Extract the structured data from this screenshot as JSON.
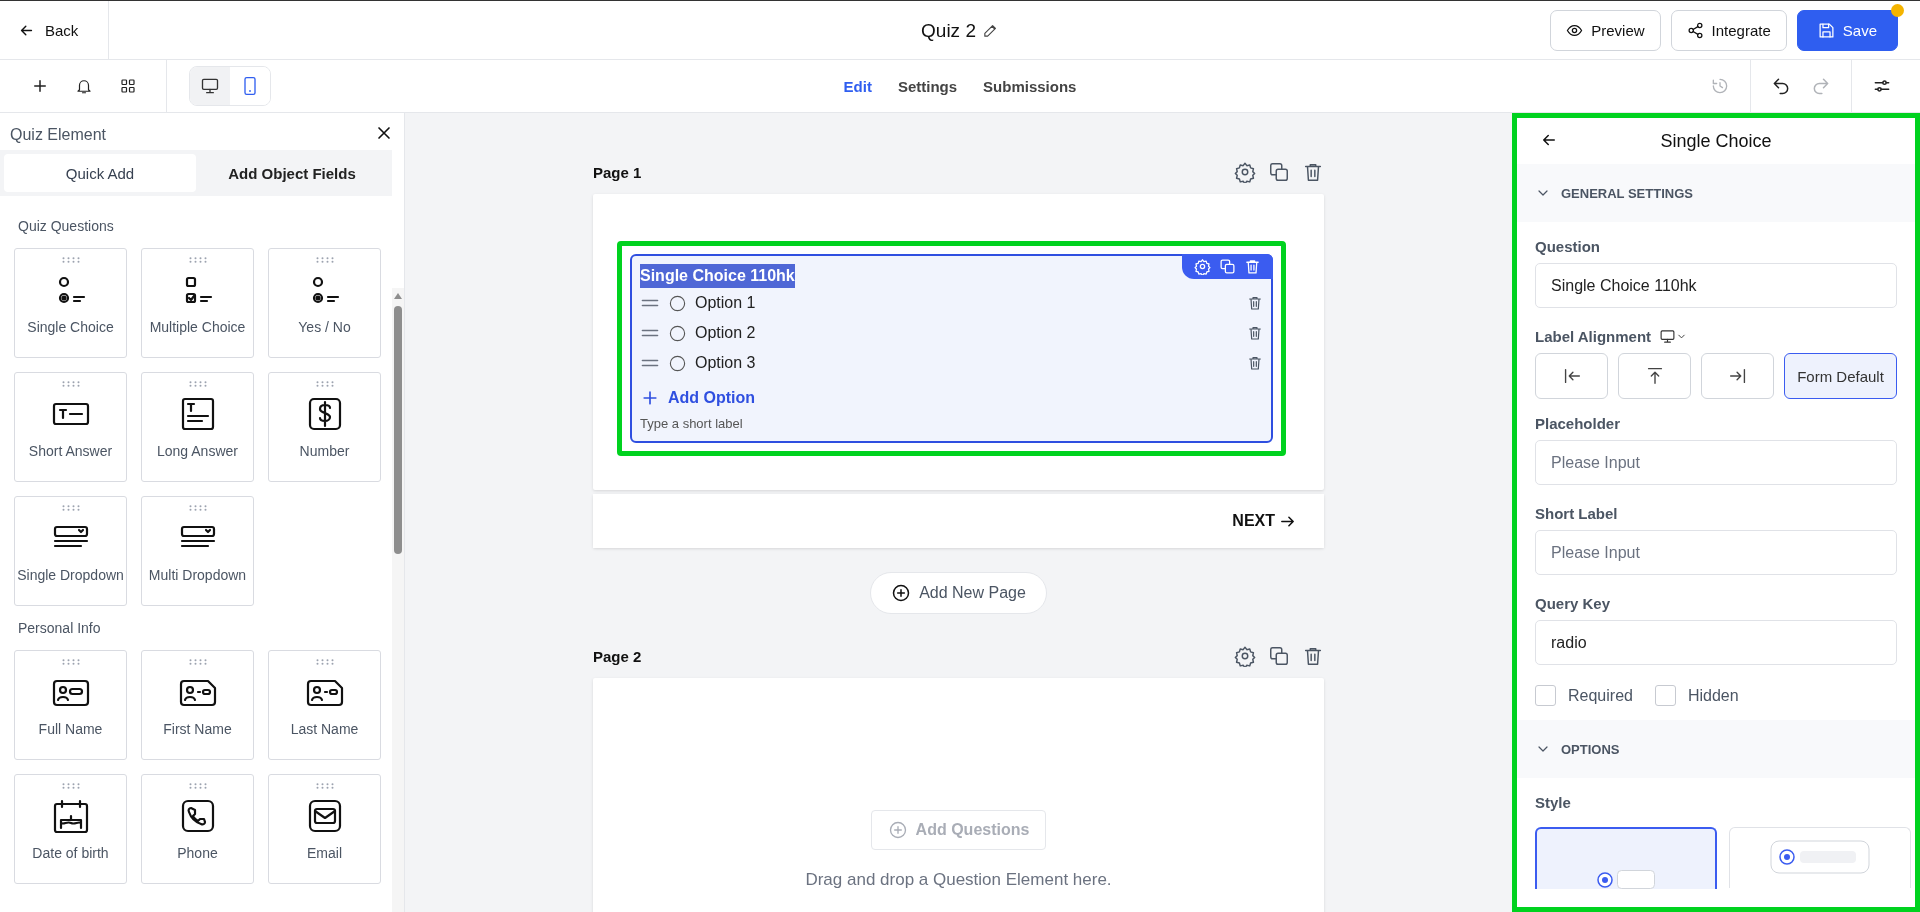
{
  "header": {
    "back": "Back",
    "title": "Quiz 2",
    "buttons": [
      {
        "label": "Preview",
        "kind": "preview",
        "unsaved": false
      },
      {
        "label": "Integrate",
        "kind": "integrate",
        "unsaved": false
      },
      {
        "label": "Save",
        "kind": "save",
        "unsaved": true
      }
    ]
  },
  "toolbar": {
    "devices": [
      {
        "kind": "desktop",
        "selected": false
      },
      {
        "kind": "mobile",
        "selected": true
      }
    ],
    "tabs": [
      {
        "label": "Edit",
        "selected": true
      },
      {
        "label": "Settings",
        "selected": false
      },
      {
        "label": "Submissions",
        "selected": false
      }
    ]
  },
  "sidebar": {
    "title": "Quiz Element",
    "tabs": [
      {
        "label": "Quick Add",
        "selected": true
      },
      {
        "label": "Add Object Fields",
        "selected": false
      }
    ],
    "sections": [
      {
        "title": "Quiz Questions",
        "items": [
          {
            "label": "Single Choice",
            "kind": "single-choice"
          },
          {
            "label": "Multiple Choice",
            "kind": "multiple-choice"
          },
          {
            "label": "Yes / No",
            "kind": "single-choice"
          },
          {
            "label": "Short Answer",
            "kind": "short-answer"
          },
          {
            "label": "Long Answer",
            "kind": "long-answer"
          },
          {
            "label": "Number",
            "kind": "number"
          },
          {
            "label": "Single Dropdown",
            "kind": "dropdown"
          },
          {
            "label": "Multi Dropdown",
            "kind": "dropdown"
          }
        ]
      },
      {
        "title": "Personal Info",
        "items": [
          {
            "label": "Full Name",
            "kind": "full-name"
          },
          {
            "label": "First Name",
            "kind": "first-name"
          },
          {
            "label": "Last Name",
            "kind": "first-name"
          },
          {
            "label": "Date of birth",
            "kind": "date"
          },
          {
            "label": "Phone",
            "kind": "phone"
          },
          {
            "label": "Email",
            "kind": "email"
          }
        ]
      }
    ]
  },
  "canvas": {
    "pages": [
      {
        "title": "Page 1",
        "next": "NEXT",
        "questions": [
          {
            "title": "Single Choice 110hk",
            "title_selected": true,
            "selected": true,
            "highlighted": true,
            "options": [
              "Option 1",
              "Option 2",
              "Option 3"
            ],
            "add_option": "Add Option",
            "hint": "Type a short label"
          }
        ]
      },
      {
        "title": "Page 2",
        "add_questions": "Add Questions",
        "empty_text": "Drag and drop a Question Element here."
      }
    ],
    "add_page": "Add New Page"
  },
  "settings": {
    "title": "Single Choice",
    "highlighted": true,
    "general": {
      "title": "GENERAL SETTINGS",
      "expanded": true
    },
    "question": {
      "label": "Question",
      "value": "Single Choice 110hk"
    },
    "alignment": {
      "label": "Label Alignment",
      "options": [
        {
          "kind": "left",
          "selected": false
        },
        {
          "kind": "top",
          "selected": false
        },
        {
          "kind": "right",
          "selected": false
        },
        {
          "kind": "default",
          "label": "Form Default",
          "selected": true
        }
      ]
    },
    "fields": [
      {
        "label": "Placeholder",
        "placeholder": "Please Input"
      },
      {
        "label": "Short Label",
        "placeholder": "Please Input"
      },
      {
        "label": "Query Key",
        "value": "radio"
      }
    ],
    "checkboxes": [
      {
        "label": "Required",
        "checked": false
      },
      {
        "label": "Hidden",
        "checked": false
      }
    ],
    "options": {
      "title": "OPTIONS",
      "expanded": true
    },
    "style": {
      "label": "Style",
      "choices": [
        {
          "kind": "stacked",
          "selected": true
        },
        {
          "kind": "inline",
          "selected": false
        }
      ]
    }
  }
}
